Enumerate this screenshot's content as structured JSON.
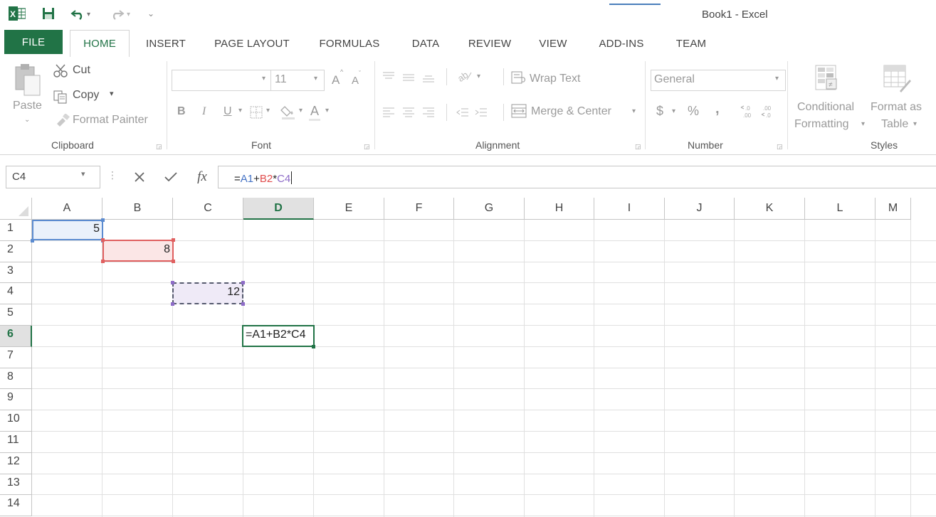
{
  "window": {
    "title": "Book1 - Excel"
  },
  "tabs": [
    {
      "label": "FILE"
    },
    {
      "label": "HOME"
    },
    {
      "label": "INSERT"
    },
    {
      "label": "PAGE LAYOUT"
    },
    {
      "label": "FORMULAS"
    },
    {
      "label": "DATA"
    },
    {
      "label": "REVIEW"
    },
    {
      "label": "VIEW"
    },
    {
      "label": "ADD-INS"
    },
    {
      "label": "TEAM"
    }
  ],
  "ribbon": {
    "clipboard": {
      "paste": "Paste",
      "cut": "Cut",
      "copy": "Copy",
      "format_painter": "Format Painter",
      "label": "Clipboard"
    },
    "font": {
      "size": "11",
      "bold": "B",
      "italic": "I",
      "underline": "U",
      "font_color": "A",
      "grow": "A",
      "shrink": "A",
      "label": "Font"
    },
    "alignment": {
      "wrap_text": "Wrap Text",
      "merge_center": "Merge & Center",
      "label": "Alignment"
    },
    "number": {
      "format": "General",
      "currency": "$",
      "percent": "%",
      "comma": ",",
      "label": "Number"
    },
    "styles": {
      "conditional": "Conditional",
      "formatting": "Formatting",
      "format_as": "Format as",
      "table": "Table",
      "label": "Styles"
    }
  },
  "formula_bar": {
    "name_box": "C4",
    "fx": "fx",
    "formula_parts": [
      {
        "text": "=",
        "color": "#222222"
      },
      {
        "text": "A1",
        "color": "#4472c4"
      },
      {
        "text": "+",
        "color": "#222222"
      },
      {
        "text": "B2",
        "color": "#e04b4b"
      },
      {
        "text": "*",
        "color": "#222222"
      },
      {
        "text": "C4",
        "color": "#8e6cc8"
      }
    ]
  },
  "grid": {
    "columns": [
      "A",
      "B",
      "C",
      "D",
      "E",
      "F",
      "G",
      "H",
      "I",
      "J",
      "K",
      "L",
      "M"
    ],
    "rows": [
      "1",
      "2",
      "3",
      "4",
      "5",
      "6",
      "7",
      "8",
      "9",
      "10",
      "11",
      "12",
      "13",
      "14"
    ],
    "selected_column": "D",
    "selected_row": "6",
    "cells": {
      "A1": "5",
      "B2": "8",
      "C4": "12",
      "D6": "=A1+B2*C4"
    }
  },
  "colors": {
    "excel_green": "#217346",
    "ref_a1": "#5b8bd0",
    "ref_b2": "#e06060",
    "ref_c4": "#8e6cc8"
  }
}
